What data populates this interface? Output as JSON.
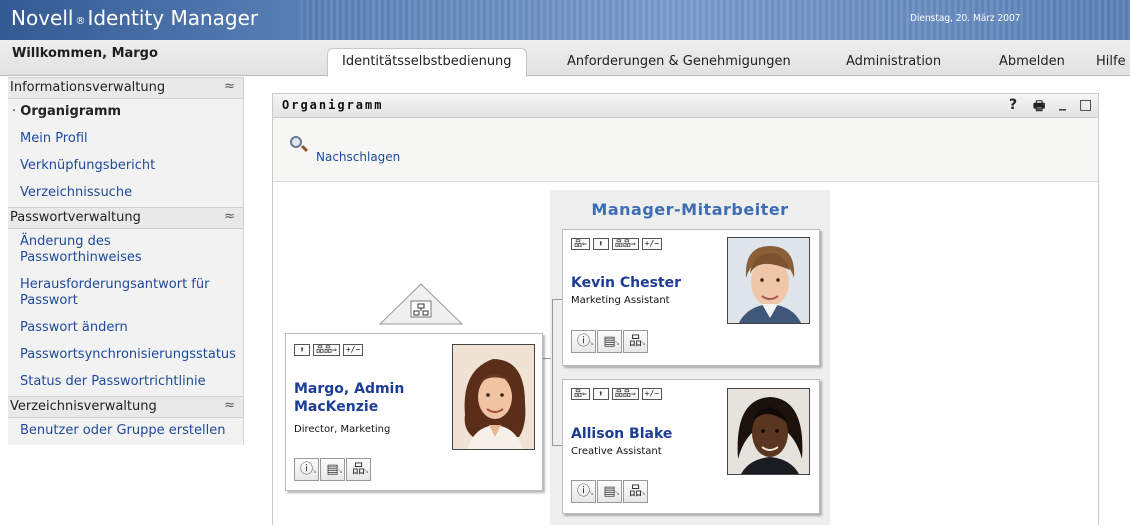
{
  "header": {
    "brand_name": "Novell",
    "brand_reg": "®",
    "brand_product": "Identity Manager",
    "date": "Dienstag, 20. März 2007"
  },
  "nav": {
    "welcome": "Willkommen, Margo",
    "tabs": [
      {
        "label": "Identitätsselbstbedienung",
        "active": true
      },
      {
        "label": "Anforderungen & Genehmigungen"
      },
      {
        "label": "Administration"
      },
      {
        "label": "Abmelden"
      },
      {
        "label": "Hilfe"
      }
    ]
  },
  "sidebar": {
    "sections": [
      {
        "title": "Informationsverwaltung",
        "items": [
          "Organigramm",
          "Mein Profil",
          "Verknüpfungsbericht",
          "Verzeichnissuche"
        ]
      },
      {
        "title": "Passwortverwaltung",
        "items": [
          "Änderung des Passworthinweises",
          "Herausforderungsantwort für Passwort",
          "Passwort ändern",
          "Passwortsynchronisierungsstatus",
          "Status der Passwortrichtlinie"
        ]
      },
      {
        "title": "Verzeichnisverwaltung",
        "items": [
          "Benutzer oder Gruppe erstellen"
        ]
      }
    ],
    "collapse_glyph": "≈"
  },
  "panel": {
    "title": "Organigramm",
    "tools": {
      "help": "?",
      "print": "🖶",
      "minimize": "_",
      "maximize": "□"
    },
    "lookup_label": "Nachschlagen"
  },
  "orgchart": {
    "group_title": "Manager-Mitarbeiter",
    "btn_labels": {
      "up_manager": "品⇐",
      "up": "⬆",
      "expand": "品品⇒",
      "toggle": "+/−"
    },
    "main_person": {
      "name_line1": "Margo, Admin",
      "name_line2": "MacKenzie",
      "title": "Director, Marketing"
    },
    "reports": [
      {
        "name": "Kevin Chester",
        "title": "Marketing Assistant"
      },
      {
        "name": "Allison Blake",
        "title": "Creative Assistant"
      }
    ]
  }
}
